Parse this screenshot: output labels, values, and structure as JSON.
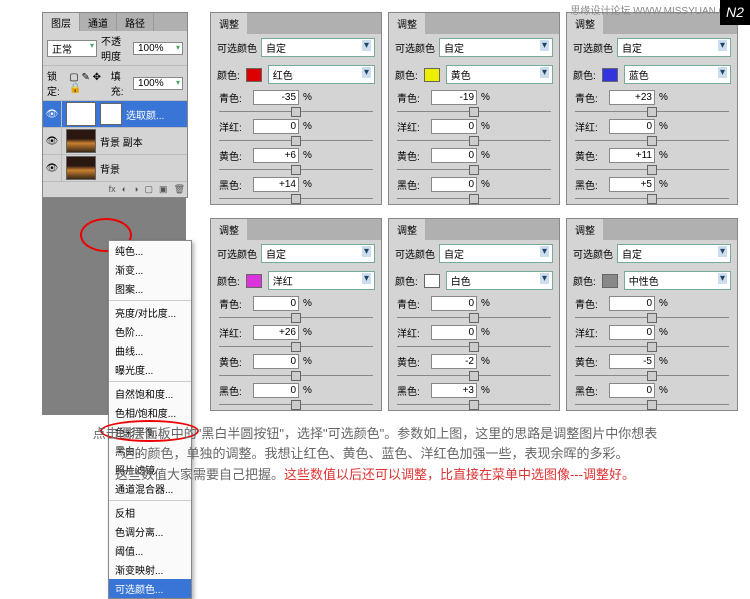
{
  "watermark": "思缘设计论坛  WWW.MISSYUAN.COM",
  "n2": "N2",
  "layers": {
    "tabs": [
      "图层",
      "通道",
      "路径"
    ],
    "mode": "正常",
    "opacity_label": "不透明度",
    "opacity": "100%",
    "lock_label": "锁定:",
    "fill_label": "填充:",
    "fill": "100%",
    "items": [
      {
        "name": "选取颜...",
        "type": "adj"
      },
      {
        "name": "背景 副本",
        "type": "img"
      },
      {
        "name": "背景",
        "type": "img"
      }
    ]
  },
  "menu": {
    "groups": [
      [
        "纯色...",
        "渐变...",
        "图案..."
      ],
      [
        "亮度/对比度...",
        "色阶...",
        "曲线...",
        "曝光度..."
      ],
      [
        "自然饱和度...",
        "色相/饱和度...",
        "色彩平衡...",
        "黑白...",
        "照片滤镜...",
        "通道混合器..."
      ],
      [
        "反相",
        "色调分离...",
        "阈值...",
        "渐变映射...",
        "可选颜色..."
      ]
    ]
  },
  "panels": [
    {
      "pos": {
        "l": 210,
        "t": 12
      },
      "preset": "自定",
      "color_label": "红色",
      "swatch": "#d00",
      "rows": [
        {
          "l": "青色:",
          "v": "-35"
        },
        {
          "l": "洋红:",
          "v": "0"
        },
        {
          "l": "黄色:",
          "v": "+6"
        },
        {
          "l": "黑色:",
          "v": "+14"
        }
      ]
    },
    {
      "pos": {
        "l": 388,
        "t": 12
      },
      "preset": "自定",
      "color_label": "黄色",
      "swatch": "#ee0",
      "rows": [
        {
          "l": "青色:",
          "v": "-19"
        },
        {
          "l": "洋红:",
          "v": "0"
        },
        {
          "l": "黄色:",
          "v": "0"
        },
        {
          "l": "黑色:",
          "v": "0"
        }
      ]
    },
    {
      "pos": {
        "l": 566,
        "t": 12
      },
      "preset": "自定",
      "color_label": "蓝色",
      "swatch": "#33d",
      "rows": [
        {
          "l": "青色:",
          "v": "+23"
        },
        {
          "l": "洋红:",
          "v": "0"
        },
        {
          "l": "黄色:",
          "v": "+11"
        },
        {
          "l": "黑色:",
          "v": "+5"
        }
      ]
    },
    {
      "pos": {
        "l": 210,
        "t": 218
      },
      "preset": "自定",
      "color_label": "洋红",
      "swatch": "#d3d",
      "rows": [
        {
          "l": "青色:",
          "v": "0"
        },
        {
          "l": "洋红:",
          "v": "+26"
        },
        {
          "l": "黄色:",
          "v": "0"
        },
        {
          "l": "黑色:",
          "v": "0"
        }
      ]
    },
    {
      "pos": {
        "l": 388,
        "t": 218
      },
      "preset": "自定",
      "color_label": "白色",
      "swatch": "#fff",
      "rows": [
        {
          "l": "青色:",
          "v": "0"
        },
        {
          "l": "洋红:",
          "v": "0"
        },
        {
          "l": "黄色:",
          "v": "-2"
        },
        {
          "l": "黑色:",
          "v": "+3"
        }
      ]
    },
    {
      "pos": {
        "l": 566,
        "t": 218
      },
      "preset": "自定",
      "color_label": "中性色",
      "swatch": "#888",
      "rows": [
        {
          "l": "青色:",
          "v": "0"
        },
        {
          "l": "洋红:",
          "v": "0"
        },
        {
          "l": "黄色:",
          "v": "-5"
        },
        {
          "l": "黑色:",
          "v": "0"
        }
      ]
    }
  ],
  "adj_label": "调整",
  "sel_color_label": "可选颜色",
  "color_prefix": "颜色:",
  "pct": "%",
  "caption": {
    "line1a": "点击图层面板中的\"黑白半圆按钮\"，选择\"可选颜色\"。参数如上图，这里的思路是调整图片中你想表",
    "line1b": "达的颜色，单独的调整。我想让红色、黄色、蓝色、洋红色加强一些，表现余晖的多彩。",
    "line2a": "这些数值大家需要自己把握。",
    "line2b": "这些数值以后还可以调整，比直接在菜单中选图像---调整好。"
  }
}
